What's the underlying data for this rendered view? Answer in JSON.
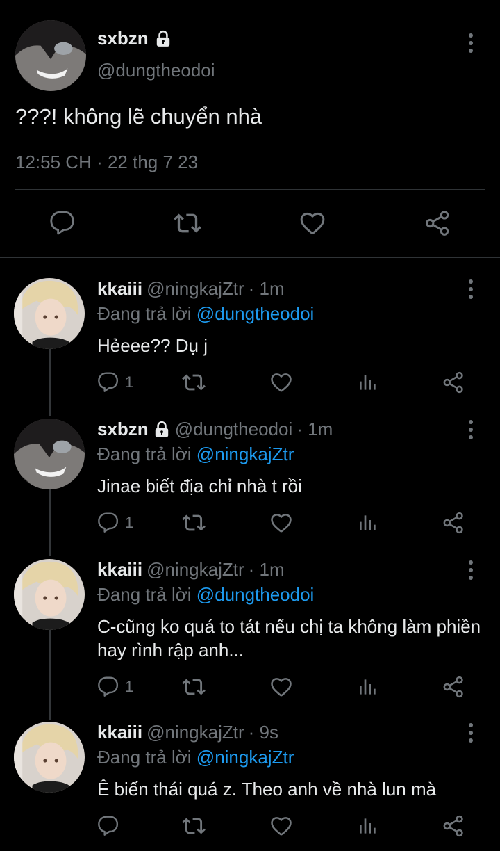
{
  "main_tweet": {
    "name": "sxbzn",
    "handle": "@dungtheodoi",
    "text": "???! không lẽ chuyển nhà",
    "timestamp": "12:55 CH · 22 thg 7 23",
    "protected_icon": "lock-icon",
    "actions": [
      "reply-icon",
      "retweet-icon",
      "like-icon",
      "share-icon"
    ]
  },
  "replies": [
    {
      "name": "kkaiii",
      "handle": "@ningkajZtr",
      "time": "· 1m",
      "replying_prefix": "Đang trả lời",
      "replying_to": "@dungtheodoi",
      "text": "Hẻeee?? Dụ j",
      "reply_count": "1",
      "protected": false
    },
    {
      "name": "sxbzn",
      "handle": "@dungtheodoi",
      "time": "· 1m",
      "replying_prefix": "Đang trả lời",
      "replying_to": "@ningkajZtr",
      "text": "Jinae biết địa chỉ nhà t rồi",
      "reply_count": "1",
      "protected": true
    },
    {
      "name": "kkaiii",
      "handle": "@ningkajZtr",
      "time": "· 1m",
      "replying_prefix": "Đang trả lời",
      "replying_to": "@dungtheodoi",
      "text": "C-cũng ko quá to tát nếu chị ta không làm phiền hay rình rập anh...",
      "reply_count": "1",
      "protected": false
    },
    {
      "name": "kkaiii",
      "handle": "@ningkajZtr",
      "time": "· 9s",
      "replying_prefix": "Đang trả lời",
      "replying_to": "@ningkajZtr",
      "text": "Ê biến thái quá z. Theo anh về nhà lun mà",
      "reply_count": "",
      "protected": false
    }
  ],
  "colors": {
    "background": "#000000",
    "text_primary": "#e7e9ea",
    "text_secondary": "#71767b",
    "accent_link": "#1d9bf0",
    "divider": "#2f3336"
  }
}
